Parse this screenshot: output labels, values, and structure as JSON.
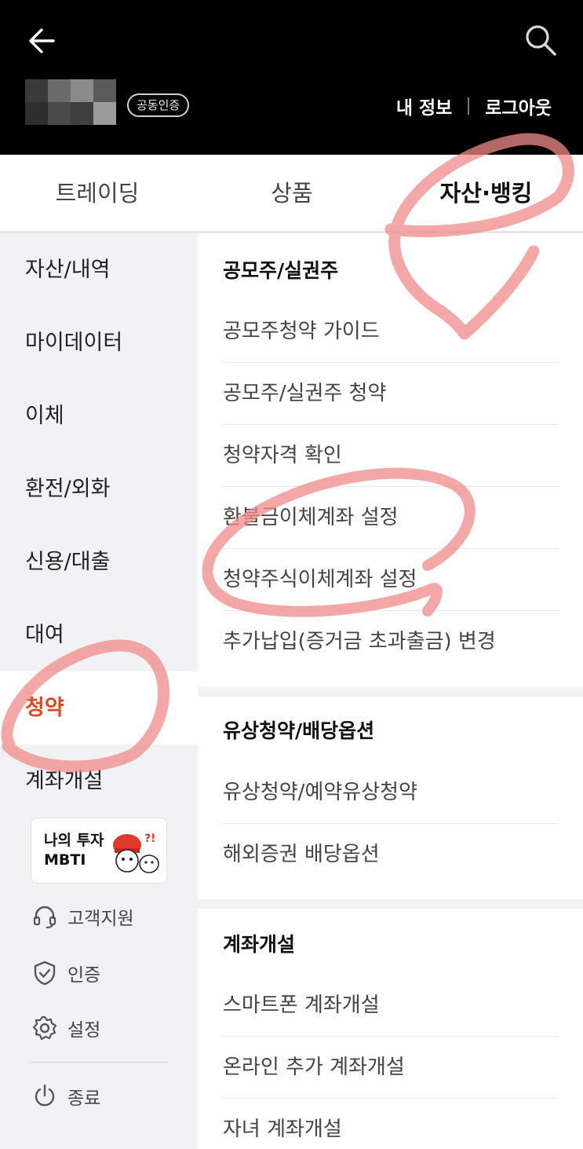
{
  "header": {
    "cert_badge": "공동인증",
    "my_info": "내 정보",
    "logout": "로그아웃"
  },
  "icons": {
    "back": "arrow-left-icon",
    "search": "search-icon"
  },
  "tabs": [
    {
      "label": "트레이딩",
      "active": false
    },
    {
      "label": "상품",
      "active": false
    },
    {
      "label": "자산·뱅킹",
      "active": true
    }
  ],
  "sidebar": {
    "items": [
      {
        "label": "자산/내역",
        "active": false
      },
      {
        "label": "마이데이터",
        "active": false
      },
      {
        "label": "이체",
        "active": false
      },
      {
        "label": "환전/외화",
        "active": false
      },
      {
        "label": "신용/대출",
        "active": false
      },
      {
        "label": "대여",
        "active": false
      },
      {
        "label": "청약",
        "active": true
      },
      {
        "label": "계좌개설",
        "active": false
      }
    ],
    "banner": "나의 투자\nMBTI",
    "utils": [
      {
        "label": "고객지원",
        "icon": "headset-icon"
      },
      {
        "label": "인증",
        "icon": "shield-check-icon"
      },
      {
        "label": "설정",
        "icon": "gear-icon"
      },
      {
        "label": "종료",
        "icon": "power-icon"
      }
    ]
  },
  "sections": [
    {
      "title": "공모주/실권주",
      "items": [
        "공모주청약 가이드",
        "공모주/실권주 청약",
        "청약자격 확인",
        "환불금이체계좌 설정",
        "청약주식이체계좌 설정",
        "추가납입(증거금 초과출금) 변경"
      ]
    },
    {
      "title": "유상청약/배당옵션",
      "items": [
        "유상청약/예약유상청약",
        "해외증권 배당옵션"
      ]
    },
    {
      "title": "계좌개설",
      "items": [
        "스마트폰 계좌개설",
        "온라인 추가 계좌개설",
        "자녀 계좌개설"
      ]
    }
  ],
  "colors": {
    "accent": "#e0481c",
    "annotation": "#f08a8a"
  }
}
